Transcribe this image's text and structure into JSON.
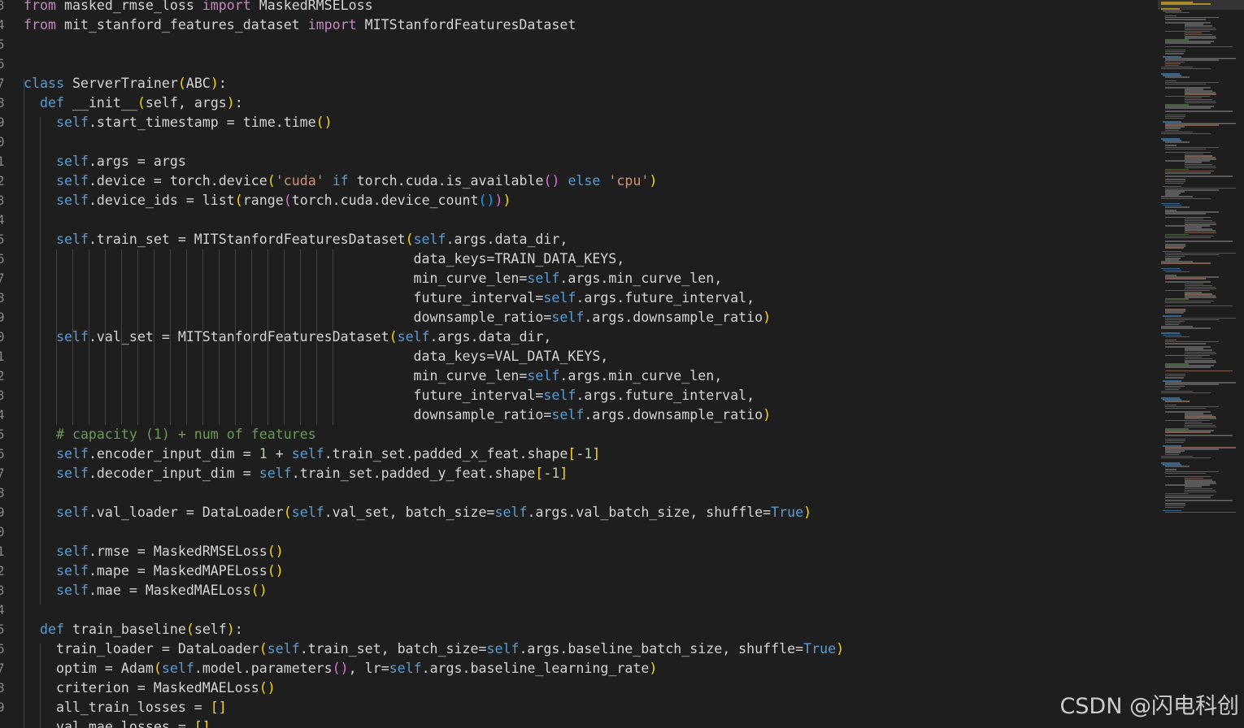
{
  "editor": {
    "line_numbers": [
      "3",
      "4",
      "5",
      "6",
      "7",
      "8",
      "9",
      "0",
      "1",
      "2",
      "3",
      "4",
      "5",
      "6",
      "7",
      "8",
      "9",
      "0",
      "1",
      "2",
      "3",
      "4",
      "5",
      "6",
      "7",
      "8",
      "9",
      "0",
      "1",
      "2",
      "3",
      "4",
      "5",
      "6",
      "7",
      "8",
      "9"
    ],
    "code_lines": [
      "from masked_rmse_loss import MaskedRMSELoss",
      "from mit_stanford_features_dataset import MITStanfordFeaturesDataset",
      "",
      "",
      "class ServerTrainer(ABC):",
      "    def __init__(self, args):",
      "        self.start_timestamp = time.time()",
      "",
      "        self.args = args",
      "        self.device = torch.device('cuda' if torch.cuda.is_available() else 'cpu')",
      "        self.device_ids = list(range(torch.cuda.device_count()))",
      "",
      "        self.train_set = MITStanfordFeaturesDataset(self.args.data_dir,",
      "                                                data_keys=TRAIN_DATA_KEYS,",
      "                                                min_curve_len=self.args.min_curve_len,",
      "                                                future_interval=self.args.future_interval,",
      "                                                downsample_ratio=self.args.downsample_ratio)",
      "        self.val_set = MITStanfordFeaturesDataset(self.args.data_dir,",
      "                                                data_keys=VAL_DATA_KEYS,",
      "                                                min_curve_len=self.args.min_curve_len,",
      "                                                future_interval=self.args.future_interval,",
      "                                                downsample_ratio=self.args.downsample_ratio)",
      "        # capacity (1) + num of features",
      "        self.encoder_input_dim = 1 + self.train_set.padded_x_feat.shape[-1]",
      "        self.decoder_input_dim = self.train_set.padded_y_feat.shape[-1]",
      "",
      "        self.val_loader = DataLoader(self.val_set, batch_size=self.args.val_batch_size, shuffle=True)",
      "",
      "        self.rmse = MaskedRMSELoss()",
      "        self.mape = MaskedMAPELoss()",
      "        self.mae = MaskedMAELoss()",
      "",
      "    def train_baseline(self):",
      "        train_loader = DataLoader(self.train_set, batch_size=self.args.baseline_batch_size, shuffle=True)",
      "        optim = Adam(self.model.parameters(), lr=self.args.baseline_learning_rate)",
      "        criterion = MaskedMAELoss()",
      "        all_train_losses = []",
      "        val_mae_losses = []"
    ],
    "theme_colors": {
      "background": "#1e1e1e",
      "keyword": "#569cd6",
      "string": "#ce9178",
      "number": "#b5cea8",
      "comment": "#6a9955",
      "text": "#d4d4d4"
    }
  },
  "watermark": {
    "text": "CSDN @闪电科创"
  }
}
